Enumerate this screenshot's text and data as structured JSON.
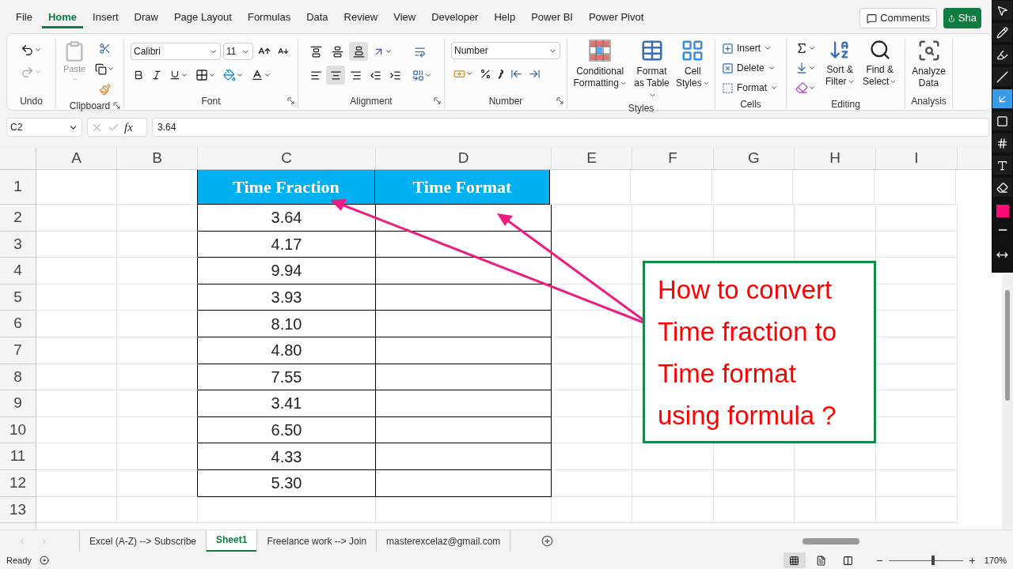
{
  "menu_tabs": [
    {
      "label": "File",
      "selected": false
    },
    {
      "label": "Home",
      "selected": true
    },
    {
      "label": "Insert",
      "selected": false
    },
    {
      "label": "Draw",
      "selected": false
    },
    {
      "label": "Page Layout",
      "selected": false
    },
    {
      "label": "Formulas",
      "selected": false
    },
    {
      "label": "Data",
      "selected": false
    },
    {
      "label": "Review",
      "selected": false
    },
    {
      "label": "View",
      "selected": false
    },
    {
      "label": "Developer",
      "selected": false
    },
    {
      "label": "Help",
      "selected": false
    },
    {
      "label": "Power BI",
      "selected": false
    },
    {
      "label": "Power Pivot",
      "selected": false
    }
  ],
  "top_buttons": {
    "comments": "Comments",
    "share": "Sha"
  },
  "ribbon": {
    "undo": {
      "label": "Undo"
    },
    "clipboard": {
      "paste": "Paste",
      "label": "Clipboard"
    },
    "font": {
      "name": "Calibri",
      "size": "11",
      "label": "Font"
    },
    "alignment": {
      "label": "Alignment",
      "top_row": [
        {
          "selected": false
        },
        {
          "selected": false
        },
        {
          "selected": true
        }
      ],
      "bottom_row": [
        {
          "selected": false
        },
        {
          "selected": true
        },
        {
          "selected": false
        },
        {
          "selected": false
        },
        {
          "selected": false
        }
      ]
    },
    "number": {
      "format": "Number",
      "label": "Number"
    },
    "styles": {
      "label": "Styles",
      "buttons": [
        "Conditional Formatting",
        "Format as Table",
        "Cell Styles"
      ]
    },
    "cells": {
      "label": "Cells",
      "buttons": [
        "Insert",
        "Delete",
        "Format"
      ]
    },
    "editing": {
      "label": "Editing",
      "buttons": [
        "Sort & Filter",
        "Find & Select"
      ]
    },
    "analysis": {
      "label": "Analysis",
      "buttons": [
        "Analyze Data"
      ]
    }
  },
  "formula_bar": {
    "name_box": "C2",
    "fx": "fx",
    "formula": "3.64"
  },
  "columns": [
    "A",
    "B",
    "C",
    "D",
    "E",
    "F",
    "G",
    "H",
    "I"
  ],
  "row_numbers": [
    "1",
    "2",
    "3",
    "4",
    "5",
    "6",
    "7",
    "8",
    "9",
    "10",
    "11",
    "12",
    "13"
  ],
  "table": {
    "headers": [
      "Time Fraction",
      "Time Format"
    ],
    "rows": [
      [
        "3.64",
        ""
      ],
      [
        "4.17",
        ""
      ],
      [
        "9.94",
        ""
      ],
      [
        "3.93",
        ""
      ],
      [
        "8.10",
        ""
      ],
      [
        "4.80",
        ""
      ],
      [
        "7.55",
        ""
      ],
      [
        "3.41",
        ""
      ],
      [
        "6.50",
        ""
      ],
      [
        "4.33",
        ""
      ],
      [
        "5.30",
        ""
      ]
    ]
  },
  "callout": {
    "lines": [
      "How to convert",
      "Time fraction to",
      "Time format",
      "using formula ?"
    ]
  },
  "sheet_tabs": [
    {
      "label": "Excel (A-Z) --> Subscribe",
      "selected": false
    },
    {
      "label": "Sheet1",
      "selected": true
    },
    {
      "label": "Freelance work --> Join",
      "selected": false
    },
    {
      "label": "masterexcelaz@gmail.com",
      "selected": false
    }
  ],
  "status_bar": {
    "status": "Ready",
    "views": [
      {
        "selected": true
      },
      {
        "selected": false
      },
      {
        "selected": false
      }
    ],
    "zoom": {
      "level": 0.6,
      "reading": "170%"
    }
  },
  "annotation_toolbar": {
    "tools": [
      {
        "selected": false
      },
      {
        "selected": false
      },
      {
        "selected": false
      },
      {
        "selected": false
      },
      {
        "selected": true
      },
      {
        "selected": false
      },
      {
        "selected": false
      },
      {
        "selected": false
      },
      {
        "selected": false
      }
    ],
    "color": "#ff0a78"
  }
}
